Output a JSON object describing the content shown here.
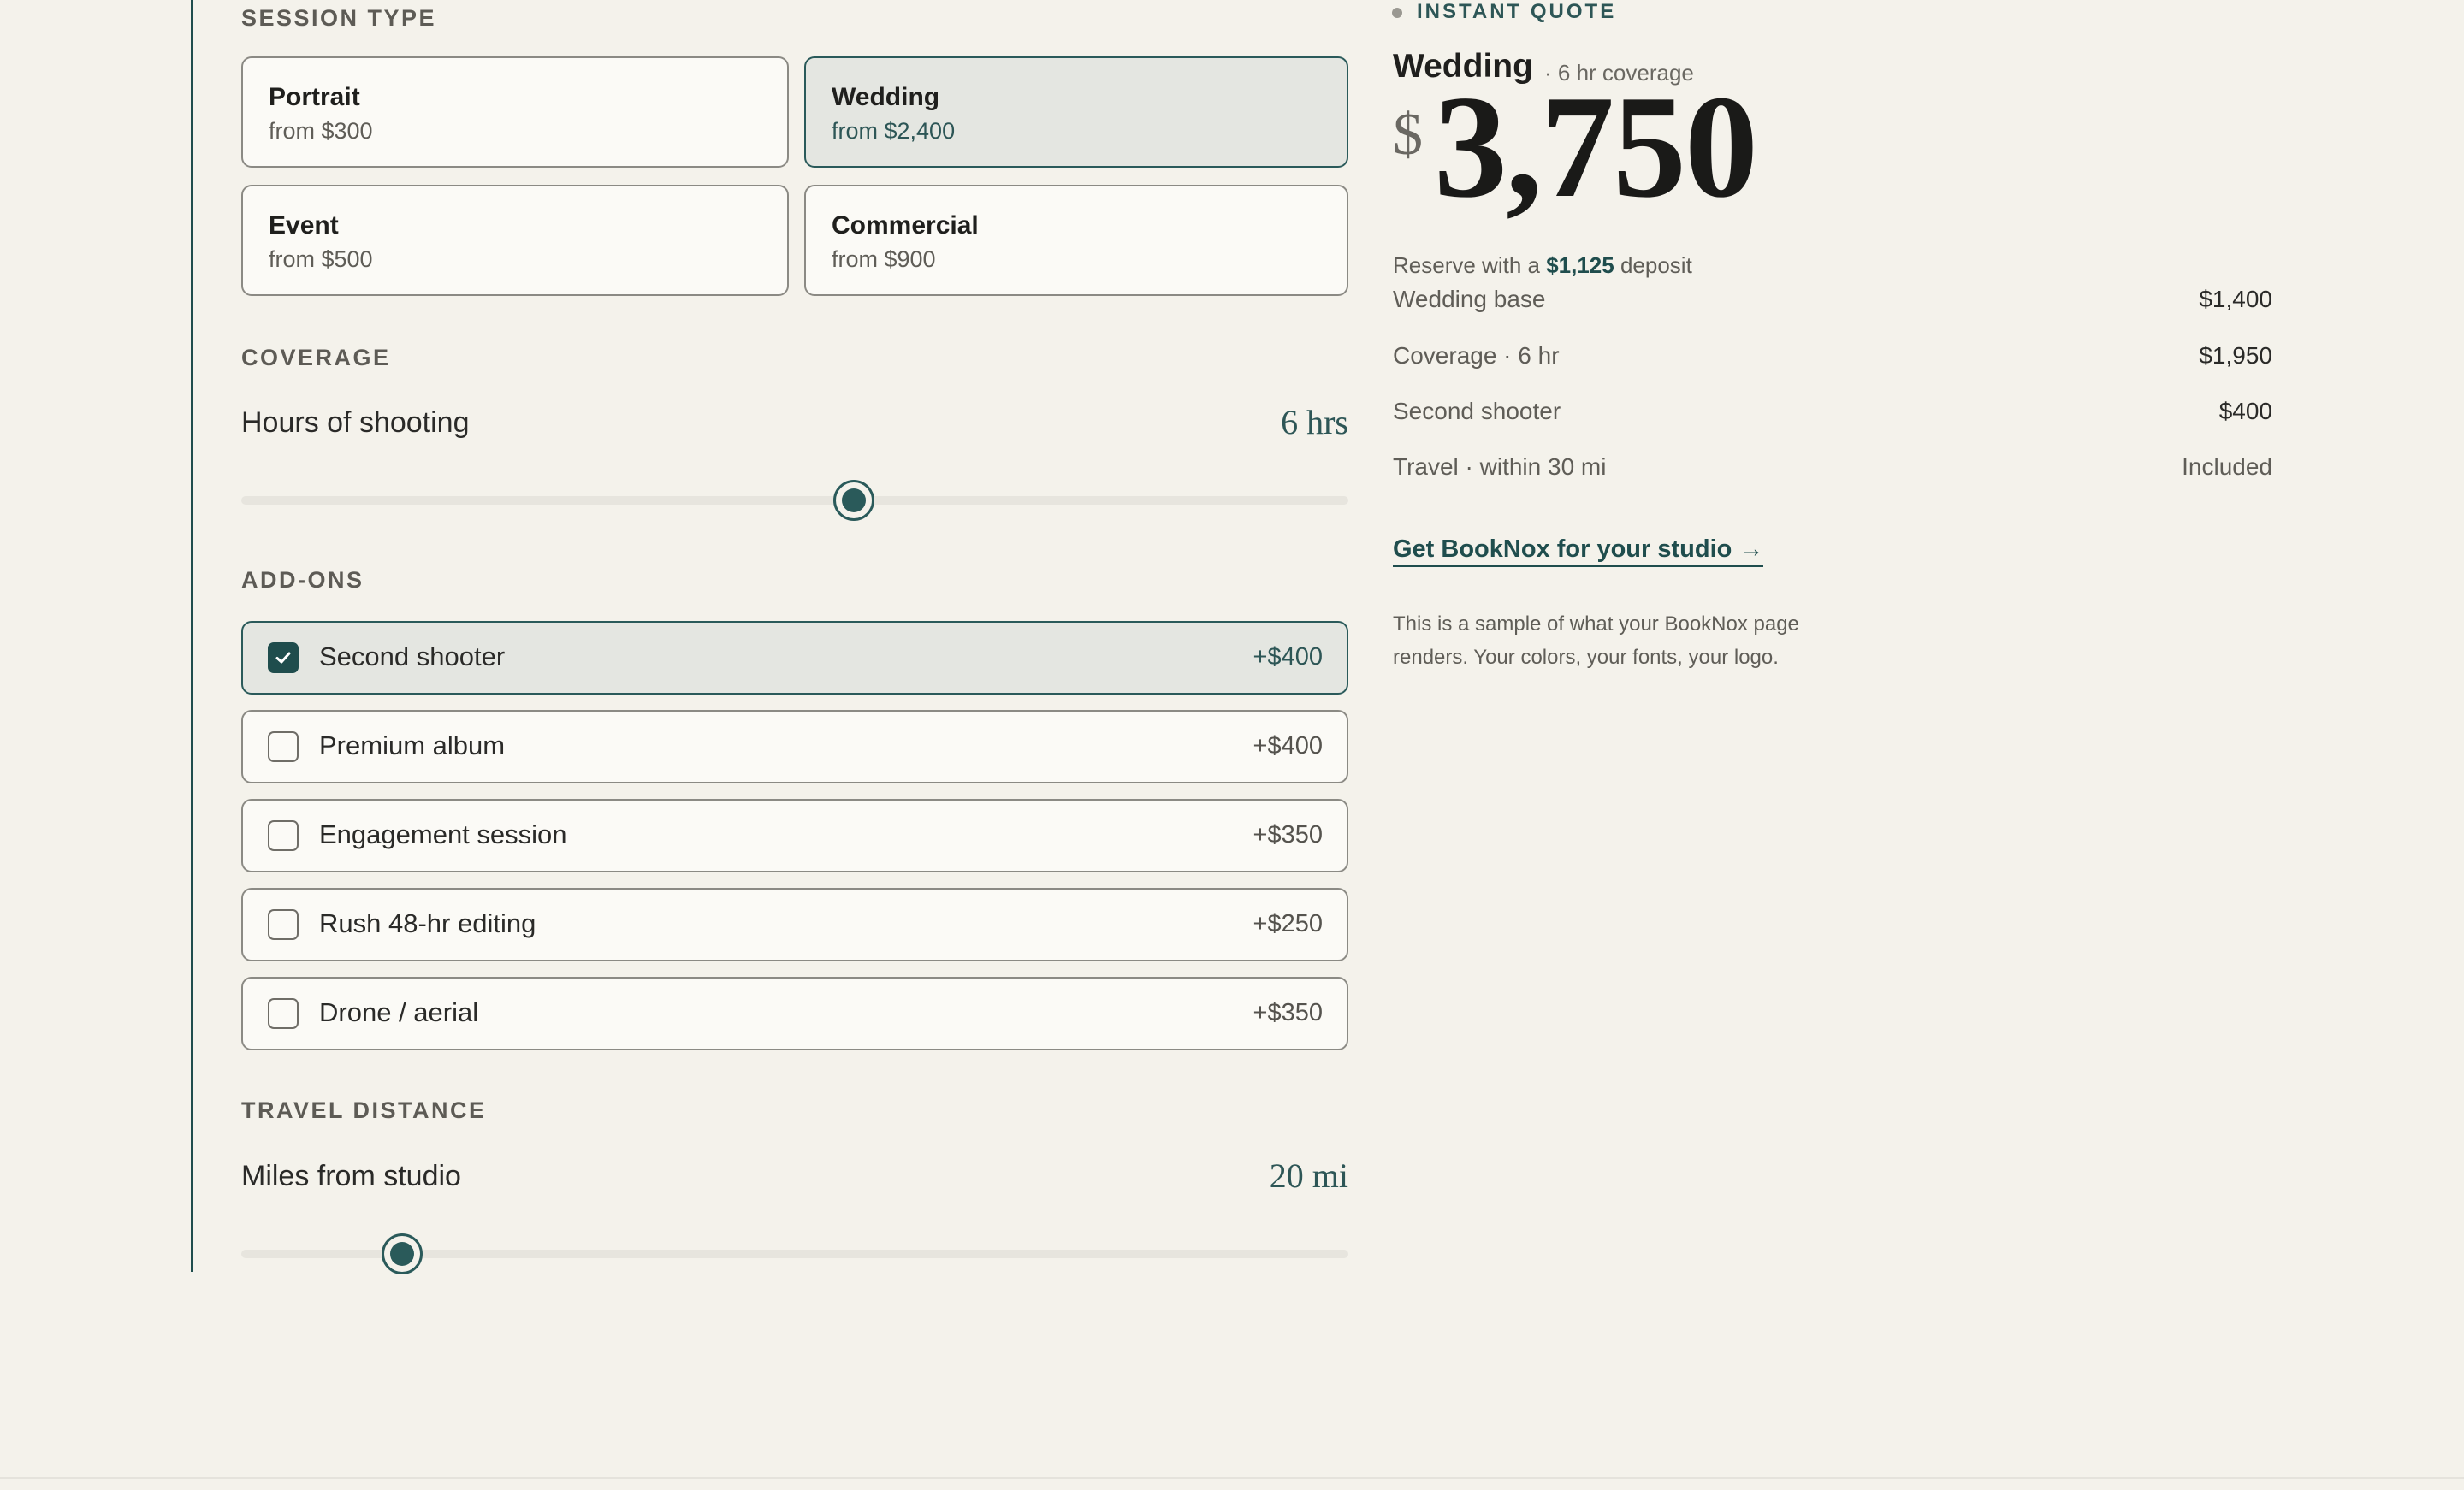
{
  "session_type": {
    "label": "SESSION TYPE",
    "options": [
      {
        "title": "Portrait",
        "sub": "from $300"
      },
      {
        "title": "Wedding",
        "sub": "from $2,400"
      },
      {
        "title": "Event",
        "sub": "from $500"
      },
      {
        "title": "Commercial",
        "sub": "from $900"
      }
    ],
    "selected": "Wedding"
  },
  "coverage": {
    "label": "COVERAGE",
    "row_label": "Hours of shooting",
    "value_text": "6 hrs",
    "slider_fraction": 0.553
  },
  "addons": {
    "label": "ADD-ONS",
    "items": [
      {
        "name": "Second shooter",
        "price": "+$400",
        "checked": true
      },
      {
        "name": "Premium album",
        "price": "+$400",
        "checked": false
      },
      {
        "name": "Engagement session",
        "price": "+$350",
        "checked": false
      },
      {
        "name": "Rush 48-hr editing",
        "price": "+$250",
        "checked": false
      },
      {
        "name": "Drone / aerial",
        "price": "+$350",
        "checked": false
      }
    ]
  },
  "travel": {
    "label": "TRAVEL DISTANCE",
    "row_label": "Miles from studio",
    "value_text": "20 mi",
    "slider_fraction": 0.145
  },
  "quote": {
    "eyebrow": "INSTANT QUOTE",
    "title": "Wedding",
    "subtitle": "· 6 hr coverage",
    "currency": "$",
    "amount": "3,750",
    "deposit_prefix": "Reserve with a",
    "deposit_amount": "$1,125",
    "deposit_suffix": "deposit",
    "line_items": [
      {
        "label": "Wedding base",
        "value": "$1,400"
      },
      {
        "label": "Coverage · 6 hr",
        "value": "$1,950"
      },
      {
        "label": "Second shooter",
        "value": "$400"
      },
      {
        "label": "Travel · within 30 mi",
        "value": "Included"
      }
    ],
    "cta": "Get BookNox for your studio →",
    "note": "This is a sample of what your BookNox page renders. Your colors, your fonts, your logo."
  },
  "colors": {
    "accent": "#1f4d4d",
    "background": "#f4f2eb",
    "card": "#fbfaf6",
    "card_selected": "#e4e6e1"
  },
  "icons": {
    "check": "check-icon",
    "status_dot": "dot-icon"
  }
}
